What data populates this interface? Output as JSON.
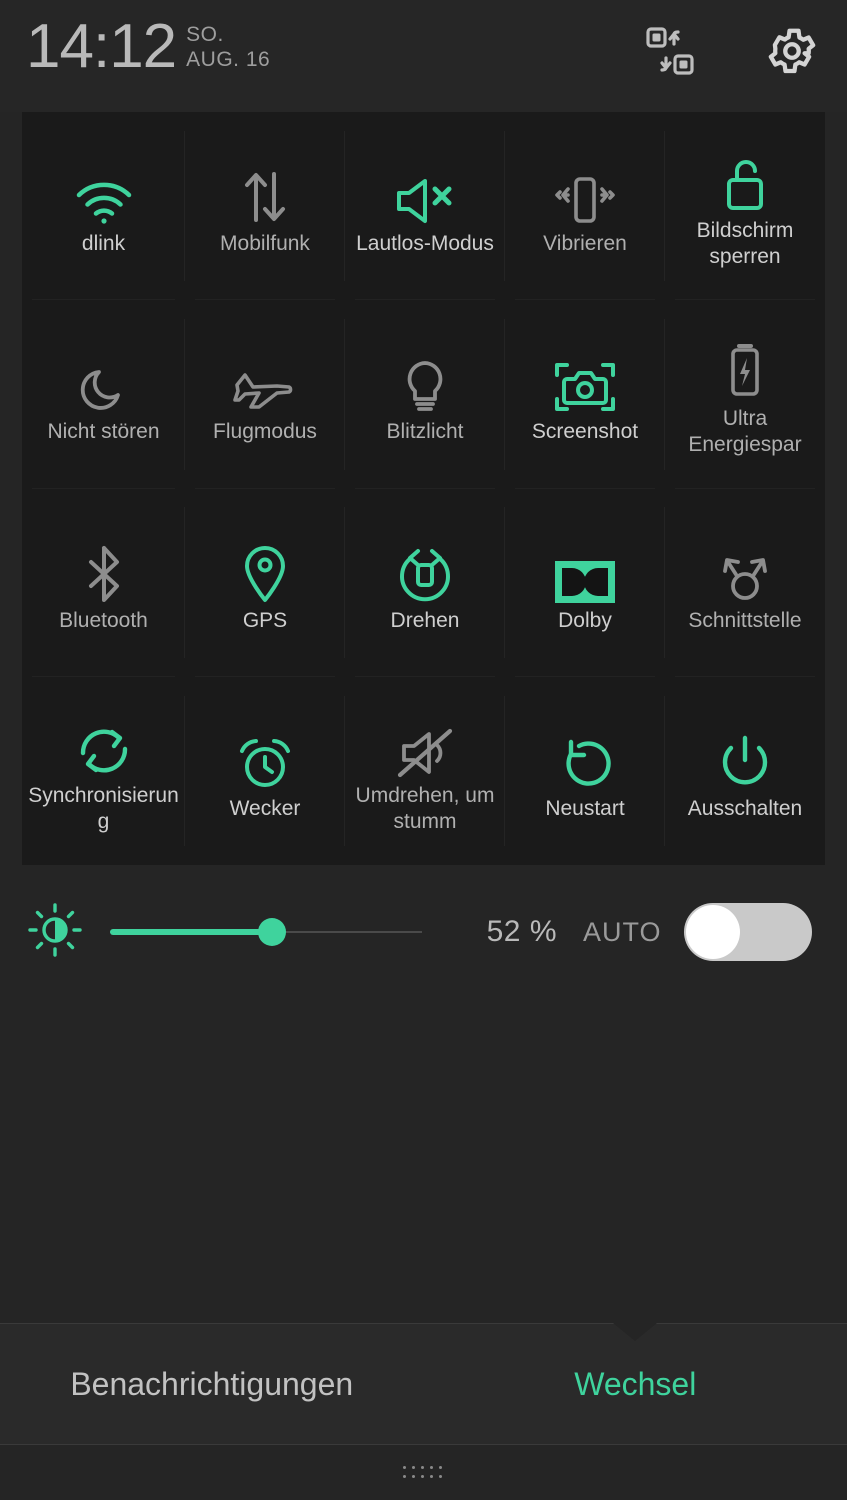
{
  "theme": {
    "accent": "#3FD39D",
    "background": "#252525",
    "panel": "#1A1A1A",
    "text_primary": "#CFCFCF",
    "text_dim": "#9A9A9A"
  },
  "statusbar": {
    "time": "14:12",
    "weekday": "SO.",
    "date": "AUG. 16",
    "icons": [
      {
        "name": "edit-tiles-icon",
        "label": "Kacheln bearbeiten"
      },
      {
        "name": "gear-icon",
        "label": "Einstellungen"
      }
    ]
  },
  "tiles": [
    {
      "label": "dlink",
      "icon": "wifi-icon",
      "active": true
    },
    {
      "label": "Mobilfunk",
      "icon": "mobile-data-icon",
      "active": false
    },
    {
      "label": "Lautlos-Modus",
      "icon": "speaker-mute-icon",
      "active": true
    },
    {
      "label": "Vibrieren",
      "icon": "vibrate-icon",
      "active": false
    },
    {
      "label": "Bildschirm sperren",
      "icon": "lock-open-icon",
      "active": true
    },
    {
      "label": "Nicht stören",
      "icon": "moon-icon",
      "active": false
    },
    {
      "label": "Flugmodus",
      "icon": "airplane-icon",
      "active": false
    },
    {
      "label": "Blitzlicht",
      "icon": "flashlight-icon",
      "active": false
    },
    {
      "label": "Screenshot",
      "icon": "camera-capture-icon",
      "active": true
    },
    {
      "label": "Ultra Energiespar",
      "icon": "battery-saver-icon",
      "active": false
    },
    {
      "label": "Bluetooth",
      "icon": "bluetooth-icon",
      "active": false
    },
    {
      "label": "GPS",
      "icon": "location-pin-icon",
      "active": true
    },
    {
      "label": "Drehen",
      "icon": "rotate-screen-icon",
      "active": true
    },
    {
      "label": "Dolby",
      "icon": "dolby-icon",
      "active": true
    },
    {
      "label": "Schnittstelle",
      "icon": "interface-icon",
      "active": false
    },
    {
      "label": "Synchronisierung",
      "icon": "sync-icon",
      "active": true
    },
    {
      "label": "Wecker",
      "icon": "alarm-clock-icon",
      "active": true
    },
    {
      "label": "Umdrehen, um stumm",
      "icon": "flip-to-mute-icon",
      "active": false
    },
    {
      "label": "Neustart",
      "icon": "restart-icon",
      "active": true
    },
    {
      "label": "Ausschalten",
      "icon": "power-icon",
      "active": true
    }
  ],
  "brightness": {
    "icon": "brightness-icon",
    "value": 52,
    "percent_label": "52 %",
    "auto_label": "AUTO",
    "auto_enabled": false
  },
  "tabs": [
    {
      "label": "Benachrichtigungen",
      "active": false
    },
    {
      "label": "Wechsel",
      "active": true
    }
  ],
  "handle": {
    "name": "drag-handle"
  }
}
